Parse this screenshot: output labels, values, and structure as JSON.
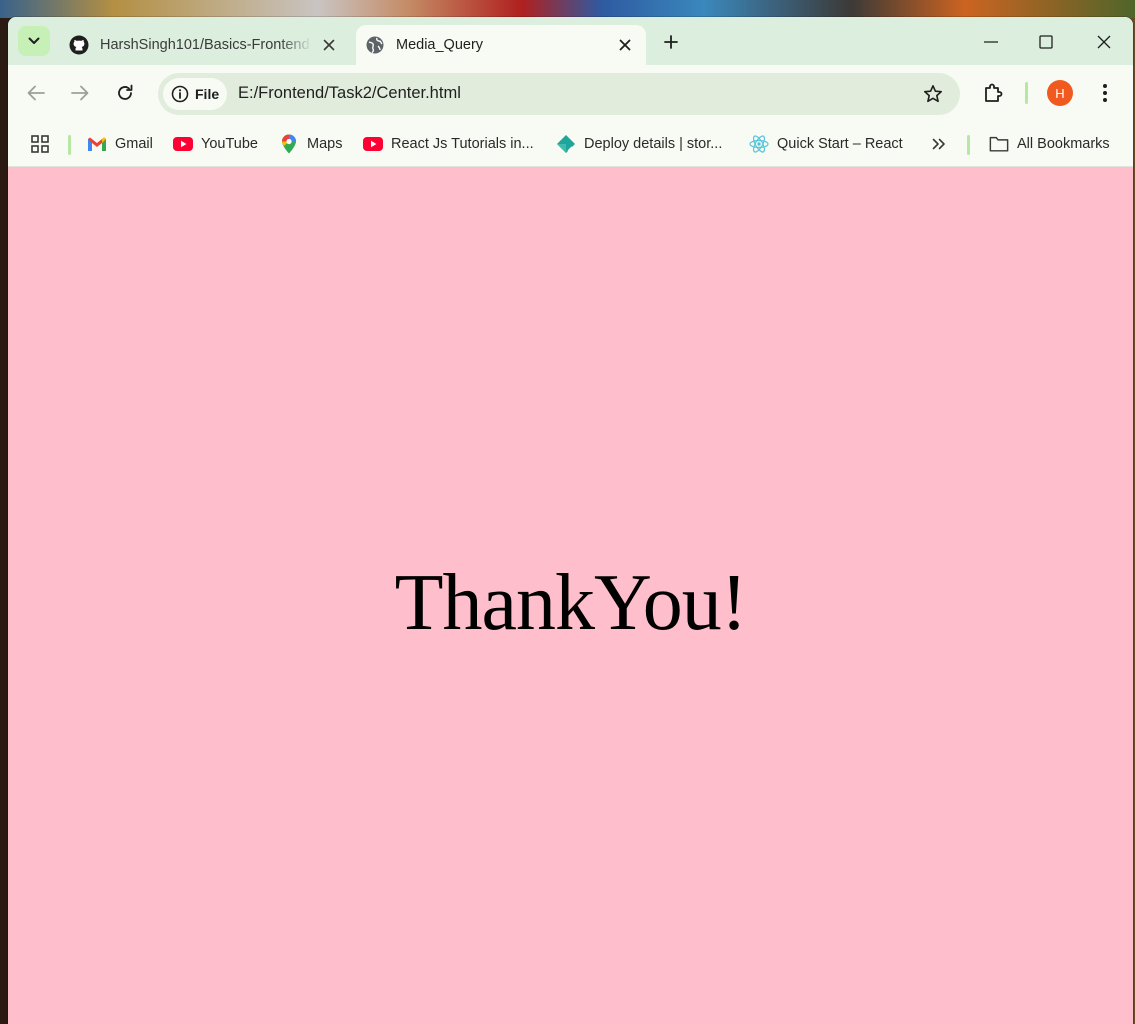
{
  "browser": {
    "tabs": [
      {
        "title": "HarshSingh101/Basics-Frontend",
        "favicon": "github-icon",
        "active": false
      },
      {
        "title": "Media_Query",
        "favicon": "globe-icon",
        "active": true
      }
    ],
    "omnibox": {
      "chip_label": "File",
      "url": "E:/Frontend/Task2/Center.html"
    },
    "profile_initial": "H",
    "colors": {
      "tab_strip": "#dceedd",
      "toolbar": "#f7fbf3",
      "avatar": "#f05a1e",
      "page_background": "#ffbecb"
    }
  },
  "bookmarks": {
    "items": [
      {
        "label": "Gmail",
        "icon": "gmail-icon"
      },
      {
        "label": "YouTube",
        "icon": "youtube-icon"
      },
      {
        "label": "Maps",
        "icon": "maps-icon"
      },
      {
        "label": "React Js Tutorials in...",
        "icon": "youtube-icon"
      },
      {
        "label": "Deploy details | stor...",
        "icon": "netlify-icon"
      },
      {
        "label": "Quick Start – React",
        "icon": "react-icon"
      }
    ],
    "overflow_icon": "chevron-double-right-icon",
    "all_bookmarks_label": "All Bookmarks"
  },
  "page": {
    "heading": "ThankYou!"
  }
}
